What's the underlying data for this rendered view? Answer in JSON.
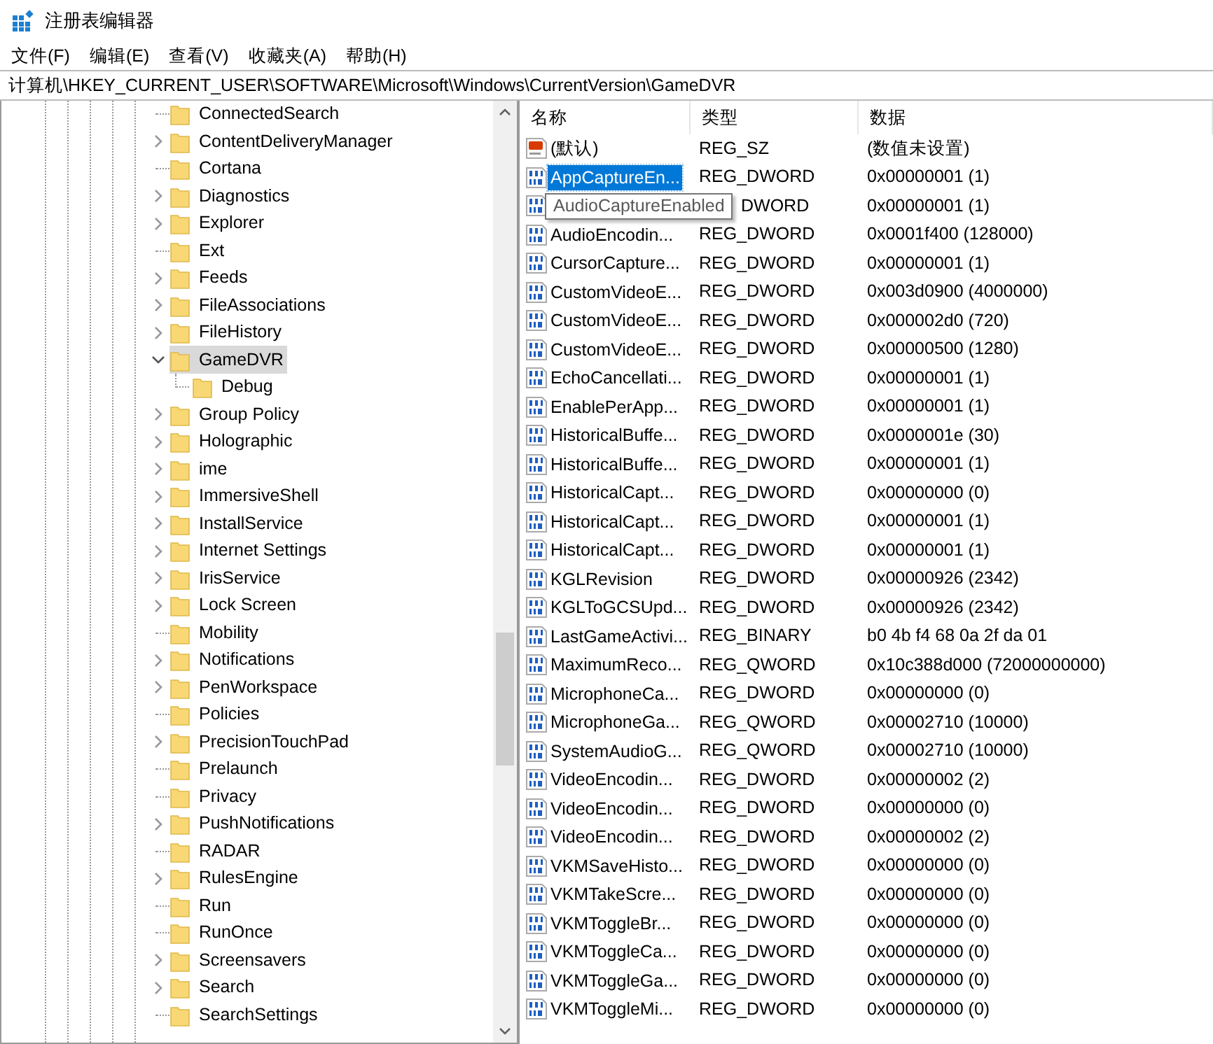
{
  "window": {
    "title": "注册表编辑器"
  },
  "menu": [
    "文件(F)",
    "编辑(E)",
    "查看(V)",
    "收藏夹(A)",
    "帮助(H)"
  ],
  "address": "计算机\\HKEY_CURRENT_USER\\SOFTWARE\\Microsoft\\Windows\\CurrentVersion\\GameDVR",
  "tree": [
    {
      "label": "ConnectedSearch",
      "kind": "leaf",
      "selected": false
    },
    {
      "label": "ContentDeliveryManager",
      "kind": "branch",
      "expanded": false,
      "selected": false
    },
    {
      "label": "Cortana",
      "kind": "leaf",
      "selected": false
    },
    {
      "label": "Diagnostics",
      "kind": "branch",
      "expanded": false,
      "selected": false
    },
    {
      "label": "Explorer",
      "kind": "branch",
      "expanded": false,
      "selected": false
    },
    {
      "label": "Ext",
      "kind": "leaf",
      "selected": false
    },
    {
      "label": "Feeds",
      "kind": "branch",
      "expanded": false,
      "selected": false
    },
    {
      "label": "FileAssociations",
      "kind": "branch",
      "expanded": false,
      "selected": false
    },
    {
      "label": "FileHistory",
      "kind": "branch",
      "expanded": false,
      "selected": false
    },
    {
      "label": "GameDVR",
      "kind": "branch",
      "expanded": true,
      "selected": true,
      "children": [
        {
          "label": "Debug",
          "kind": "leaf",
          "selected": false
        }
      ]
    },
    {
      "label": "Group Policy",
      "kind": "branch",
      "expanded": false,
      "selected": false
    },
    {
      "label": "Holographic",
      "kind": "branch",
      "expanded": false,
      "selected": false
    },
    {
      "label": "ime",
      "kind": "branch",
      "expanded": false,
      "selected": false
    },
    {
      "label": "ImmersiveShell",
      "kind": "branch",
      "expanded": false,
      "selected": false
    },
    {
      "label": "InstallService",
      "kind": "branch",
      "expanded": false,
      "selected": false
    },
    {
      "label": "Internet Settings",
      "kind": "branch",
      "expanded": false,
      "selected": false
    },
    {
      "label": "IrisService",
      "kind": "branch",
      "expanded": false,
      "selected": false
    },
    {
      "label": "Lock Screen",
      "kind": "branch",
      "expanded": false,
      "selected": false
    },
    {
      "label": "Mobility",
      "kind": "leaf",
      "selected": false
    },
    {
      "label": "Notifications",
      "kind": "branch",
      "expanded": false,
      "selected": false
    },
    {
      "label": "PenWorkspace",
      "kind": "branch",
      "expanded": false,
      "selected": false
    },
    {
      "label": "Policies",
      "kind": "leaf",
      "selected": false
    },
    {
      "label": "PrecisionTouchPad",
      "kind": "branch",
      "expanded": false,
      "selected": false
    },
    {
      "label": "Prelaunch",
      "kind": "leaf",
      "selected": false
    },
    {
      "label": "Privacy",
      "kind": "leaf",
      "selected": false
    },
    {
      "label": "PushNotifications",
      "kind": "branch",
      "expanded": false,
      "selected": false
    },
    {
      "label": "RADAR",
      "kind": "leaf",
      "selected": false
    },
    {
      "label": "RulesEngine",
      "kind": "branch",
      "expanded": false,
      "selected": false
    },
    {
      "label": "Run",
      "kind": "leaf",
      "selected": false
    },
    {
      "label": "RunOnce",
      "kind": "leaf",
      "selected": false
    },
    {
      "label": "Screensavers",
      "kind": "branch",
      "expanded": false,
      "selected": false
    },
    {
      "label": "Search",
      "kind": "branch",
      "expanded": false,
      "selected": false
    },
    {
      "label": "SearchSettings",
      "kind": "leaf",
      "selected": false
    }
  ],
  "table": {
    "columns": [
      "名称",
      "类型",
      "数据"
    ],
    "rows": [
      {
        "kind": "string",
        "name": "(默认)",
        "type": "REG_SZ",
        "data": "(数值未设置)",
        "selected": false
      },
      {
        "kind": "binary",
        "name": "AppCaptureEn...",
        "type": "REG_DWORD",
        "data": "0x00000001 (1)",
        "selected": true
      },
      {
        "kind": "binary",
        "tooltip": "AudioCaptureEnabled",
        "type": "DWORD",
        "data": "0x00000001 (1)",
        "selected": false
      },
      {
        "kind": "binary",
        "name": "AudioEncodin...",
        "type": "REG_DWORD",
        "data": "0x0001f400 (128000)",
        "selected": false
      },
      {
        "kind": "binary",
        "name": "CursorCapture...",
        "type": "REG_DWORD",
        "data": "0x00000001 (1)",
        "selected": false
      },
      {
        "kind": "binary",
        "name": "CustomVideoE...",
        "type": "REG_DWORD",
        "data": "0x003d0900 (4000000)",
        "selected": false
      },
      {
        "kind": "binary",
        "name": "CustomVideoE...",
        "type": "REG_DWORD",
        "data": "0x000002d0 (720)",
        "selected": false
      },
      {
        "kind": "binary",
        "name": "CustomVideoE...",
        "type": "REG_DWORD",
        "data": "0x00000500 (1280)",
        "selected": false
      },
      {
        "kind": "binary",
        "name": "EchoCancellati...",
        "type": "REG_DWORD",
        "data": "0x00000001 (1)",
        "selected": false
      },
      {
        "kind": "binary",
        "name": "EnablePerApp...",
        "type": "REG_DWORD",
        "data": "0x00000001 (1)",
        "selected": false
      },
      {
        "kind": "binary",
        "name": "HistoricalBuffe...",
        "type": "REG_DWORD",
        "data": "0x0000001e (30)",
        "selected": false
      },
      {
        "kind": "binary",
        "name": "HistoricalBuffe...",
        "type": "REG_DWORD",
        "data": "0x00000001 (1)",
        "selected": false
      },
      {
        "kind": "binary",
        "name": "HistoricalCapt...",
        "type": "REG_DWORD",
        "data": "0x00000000 (0)",
        "selected": false
      },
      {
        "kind": "binary",
        "name": "HistoricalCapt...",
        "type": "REG_DWORD",
        "data": "0x00000001 (1)",
        "selected": false
      },
      {
        "kind": "binary",
        "name": "HistoricalCapt...",
        "type": "REG_DWORD",
        "data": "0x00000001 (1)",
        "selected": false
      },
      {
        "kind": "binary",
        "name": "KGLRevision",
        "type": "REG_DWORD",
        "data": "0x00000926 (2342)",
        "selected": false
      },
      {
        "kind": "binary",
        "name": "KGLToGCSUpd...",
        "type": "REG_DWORD",
        "data": "0x00000926 (2342)",
        "selected": false
      },
      {
        "kind": "binary",
        "name": "LastGameActivi...",
        "type": "REG_BINARY",
        "data": "b0 4b f4 68 0a 2f da 01",
        "selected": false
      },
      {
        "kind": "binary",
        "name": "MaximumReco...",
        "type": "REG_QWORD",
        "data": "0x10c388d000 (72000000000)",
        "selected": false
      },
      {
        "kind": "binary",
        "name": "MicrophoneCa...",
        "type": "REG_DWORD",
        "data": "0x00000000 (0)",
        "selected": false
      },
      {
        "kind": "binary",
        "name": "MicrophoneGa...",
        "type": "REG_QWORD",
        "data": "0x00002710 (10000)",
        "selected": false
      },
      {
        "kind": "binary",
        "name": "SystemAudioG...",
        "type": "REG_QWORD",
        "data": "0x00002710 (10000)",
        "selected": false
      },
      {
        "kind": "binary",
        "name": "VideoEncodin...",
        "type": "REG_DWORD",
        "data": "0x00000002 (2)",
        "selected": false
      },
      {
        "kind": "binary",
        "name": "VideoEncodin...",
        "type": "REG_DWORD",
        "data": "0x00000000 (0)",
        "selected": false
      },
      {
        "kind": "binary",
        "name": "VideoEncodin...",
        "type": "REG_DWORD",
        "data": "0x00000002 (2)",
        "selected": false
      },
      {
        "kind": "binary",
        "name": "VKMSaveHisto...",
        "type": "REG_DWORD",
        "data": "0x00000000 (0)",
        "selected": false
      },
      {
        "kind": "binary",
        "name": "VKMTakeScre...",
        "type": "REG_DWORD",
        "data": "0x00000000 (0)",
        "selected": false
      },
      {
        "kind": "binary",
        "name": "VKMToggleBr...",
        "type": "REG_DWORD",
        "data": "0x00000000 (0)",
        "selected": false
      },
      {
        "kind": "binary",
        "name": "VKMToggleCa...",
        "type": "REG_DWORD",
        "data": "0x00000000 (0)",
        "selected": false
      },
      {
        "kind": "binary",
        "name": "VKMToggleGa...",
        "type": "REG_DWORD",
        "data": "0x00000000 (0)",
        "selected": false
      },
      {
        "kind": "binary",
        "name": "VKMToggleMi...",
        "type": "REG_DWORD",
        "data": "0x00000000 (0)",
        "selected": false
      }
    ]
  }
}
